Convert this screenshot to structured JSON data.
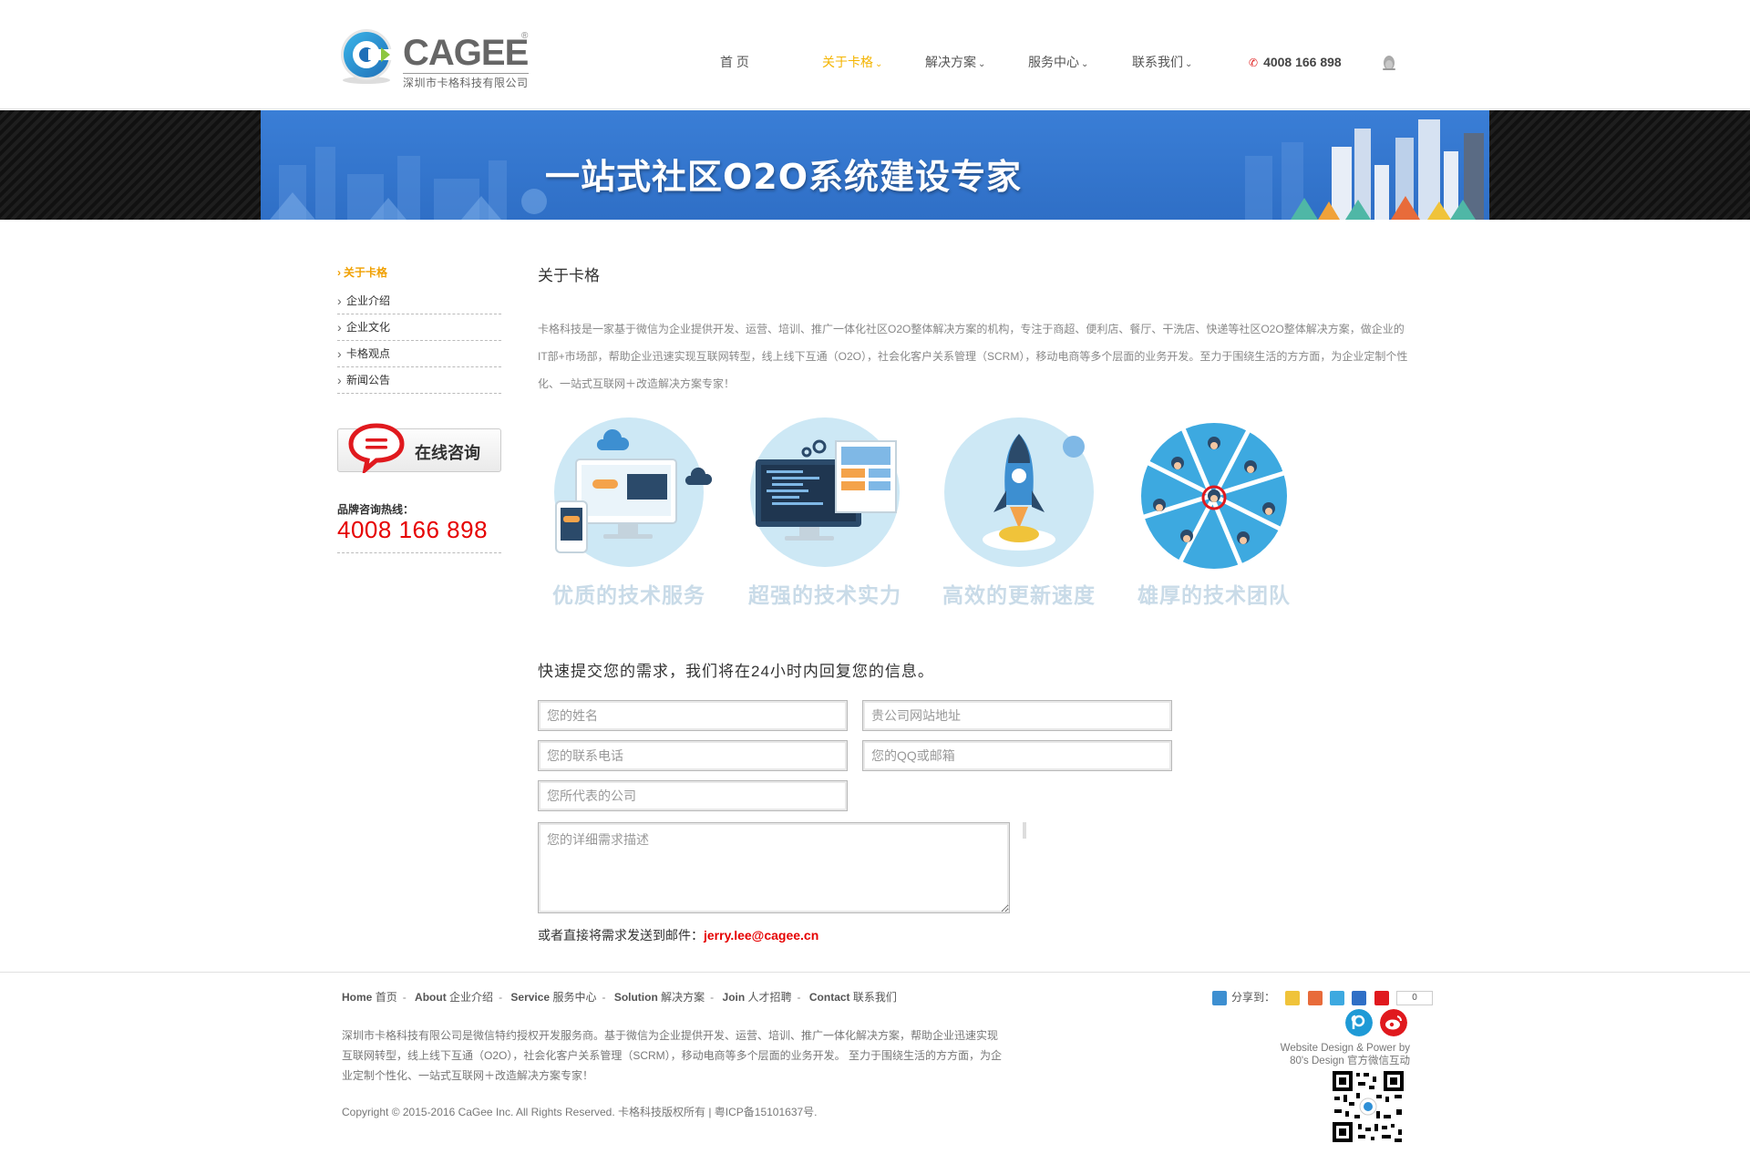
{
  "colors": {
    "accent": "#f4b400",
    "brand_blue": "#2f6fc6",
    "hotline_red": "#e60000"
  },
  "logo": {
    "name": "CAGEE",
    "registered": "®",
    "subtitle": "深圳市卡格科技有限公司"
  },
  "nav": {
    "items": [
      {
        "label": "首 页",
        "caret": ""
      },
      {
        "label": "关于卡格",
        "caret": "⌄"
      },
      {
        "label": "解决方案",
        "caret": "⌄"
      },
      {
        "label": "服务中心",
        "caret": "⌄"
      },
      {
        "label": "联系我们",
        "caret": "⌄"
      }
    ],
    "active_index": 1
  },
  "header_phone": "4008 166 898",
  "banner": {
    "title": "一站式社区O2O系统建设专家"
  },
  "sidebar": {
    "title": "关于卡格",
    "items": [
      "企业介绍",
      "企业文化",
      "卡格观点",
      "新闻公告"
    ],
    "consult_label": "在线咨询",
    "hotline_label": "品牌咨询热线：",
    "hotline_number": "4008 166 898"
  },
  "main": {
    "title": "关于卡格",
    "intro": "卡格科技是一家基于微信为企业提供开发、运营、培训、推广一体化社区O2O整体解决方案的机构，专注于商超、便利店、餐厅、干洗店、快递等社区O2O整体解决方案，做企业的IT部+市场部，帮助企业迅速实现互联网转型，线上线下互通（O2O），社会化客户关系管理（SCRM），移动电商等多个层面的业务开发。至力于围绕生活的方方面，为企业定制个性化、一站式互联网＋改造解决方案专家！",
    "features": [
      {
        "label": "优质的技术服务",
        "icon": "devices-icon"
      },
      {
        "label": "超强的技术实力",
        "icon": "code-screen-icon"
      },
      {
        "label": "高效的更新速度",
        "icon": "rocket-icon"
      },
      {
        "label": "雄厚的技术团队",
        "icon": "team-icon"
      }
    ]
  },
  "form": {
    "title": "快速提交您的需求，我们将在24小时内回复您的信息。",
    "name_placeholder": "您的姓名",
    "website_placeholder": "贵公司网站地址",
    "phone_placeholder": "您的联系电话",
    "qq_placeholder": "您的QQ或邮箱",
    "company_placeholder": "您所代表的公司",
    "detail_placeholder": "您的详细需求描述",
    "email_prefix": "或者直接将需求发送到邮件：",
    "email": "jerry.lee@cagee.cn"
  },
  "footer": {
    "links": [
      {
        "en": "Home",
        "cn": "首页"
      },
      {
        "en": "About",
        "cn": "企业介绍"
      },
      {
        "en": "Service",
        "cn": "服务中心"
      },
      {
        "en": "Solution",
        "cn": "解决方案"
      },
      {
        "en": "Join",
        "cn": "人才招聘"
      },
      {
        "en": "Contact",
        "cn": "联系我们"
      }
    ],
    "separator": "-",
    "text": "深圳市卡格科技有限公司是微信特约授权开发服务商。基于微信为企业提供开发、运营、培训、推广一体化解决方案，帮助企业迅速实现互联网转型，线上线下互通（O2O），社会化客户关系管理（SCRM），移动电商等多个层面的业务开发。 至力于围绕生活的方方面，为企业定制个性化、一站式互联网＋改造解决方案专家！",
    "copyright": "Copyright © 2015-2016 CaGee Inc. All Rights Reserved. 卡格科技版权所有 | 粤ICP备15101637号.",
    "share_label": "分享到：",
    "share_count": "0",
    "credit_line1": "Website Design & Power by",
    "credit_line2": "80's Design 官方微信互动"
  }
}
